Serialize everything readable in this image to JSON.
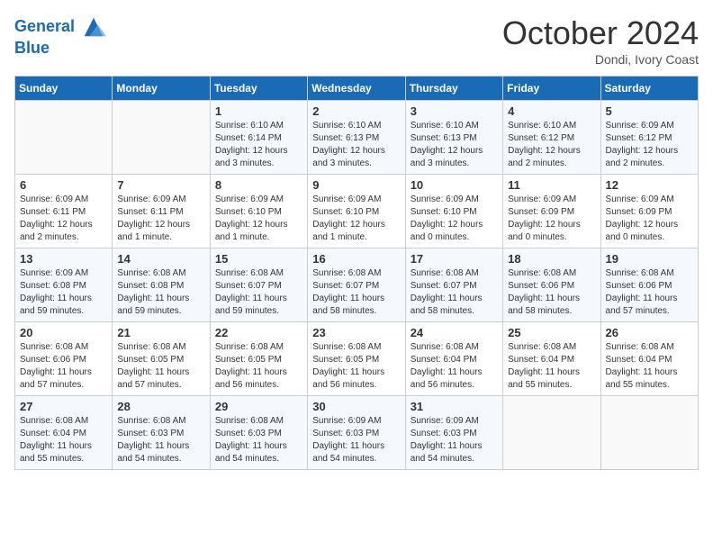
{
  "header": {
    "logo_line1": "General",
    "logo_line2": "Blue",
    "month": "October 2024",
    "location": "Dondi, Ivory Coast"
  },
  "days_of_week": [
    "Sunday",
    "Monday",
    "Tuesday",
    "Wednesday",
    "Thursday",
    "Friday",
    "Saturday"
  ],
  "weeks": [
    [
      {
        "day": "",
        "detail": ""
      },
      {
        "day": "",
        "detail": ""
      },
      {
        "day": "1",
        "detail": "Sunrise: 6:10 AM\nSunset: 6:14 PM\nDaylight: 12 hours and 3 minutes."
      },
      {
        "day": "2",
        "detail": "Sunrise: 6:10 AM\nSunset: 6:13 PM\nDaylight: 12 hours and 3 minutes."
      },
      {
        "day": "3",
        "detail": "Sunrise: 6:10 AM\nSunset: 6:13 PM\nDaylight: 12 hours and 3 minutes."
      },
      {
        "day": "4",
        "detail": "Sunrise: 6:10 AM\nSunset: 6:12 PM\nDaylight: 12 hours and 2 minutes."
      },
      {
        "day": "5",
        "detail": "Sunrise: 6:09 AM\nSunset: 6:12 PM\nDaylight: 12 hours and 2 minutes."
      }
    ],
    [
      {
        "day": "6",
        "detail": "Sunrise: 6:09 AM\nSunset: 6:11 PM\nDaylight: 12 hours and 2 minutes."
      },
      {
        "day": "7",
        "detail": "Sunrise: 6:09 AM\nSunset: 6:11 PM\nDaylight: 12 hours and 1 minute."
      },
      {
        "day": "8",
        "detail": "Sunrise: 6:09 AM\nSunset: 6:10 PM\nDaylight: 12 hours and 1 minute."
      },
      {
        "day": "9",
        "detail": "Sunrise: 6:09 AM\nSunset: 6:10 PM\nDaylight: 12 hours and 1 minute."
      },
      {
        "day": "10",
        "detail": "Sunrise: 6:09 AM\nSunset: 6:10 PM\nDaylight: 12 hours and 0 minutes."
      },
      {
        "day": "11",
        "detail": "Sunrise: 6:09 AM\nSunset: 6:09 PM\nDaylight: 12 hours and 0 minutes."
      },
      {
        "day": "12",
        "detail": "Sunrise: 6:09 AM\nSunset: 6:09 PM\nDaylight: 12 hours and 0 minutes."
      }
    ],
    [
      {
        "day": "13",
        "detail": "Sunrise: 6:09 AM\nSunset: 6:08 PM\nDaylight: 11 hours and 59 minutes."
      },
      {
        "day": "14",
        "detail": "Sunrise: 6:08 AM\nSunset: 6:08 PM\nDaylight: 11 hours and 59 minutes."
      },
      {
        "day": "15",
        "detail": "Sunrise: 6:08 AM\nSunset: 6:07 PM\nDaylight: 11 hours and 59 minutes."
      },
      {
        "day": "16",
        "detail": "Sunrise: 6:08 AM\nSunset: 6:07 PM\nDaylight: 11 hours and 58 minutes."
      },
      {
        "day": "17",
        "detail": "Sunrise: 6:08 AM\nSunset: 6:07 PM\nDaylight: 11 hours and 58 minutes."
      },
      {
        "day": "18",
        "detail": "Sunrise: 6:08 AM\nSunset: 6:06 PM\nDaylight: 11 hours and 58 minutes."
      },
      {
        "day": "19",
        "detail": "Sunrise: 6:08 AM\nSunset: 6:06 PM\nDaylight: 11 hours and 57 minutes."
      }
    ],
    [
      {
        "day": "20",
        "detail": "Sunrise: 6:08 AM\nSunset: 6:06 PM\nDaylight: 11 hours and 57 minutes."
      },
      {
        "day": "21",
        "detail": "Sunrise: 6:08 AM\nSunset: 6:05 PM\nDaylight: 11 hours and 57 minutes."
      },
      {
        "day": "22",
        "detail": "Sunrise: 6:08 AM\nSunset: 6:05 PM\nDaylight: 11 hours and 56 minutes."
      },
      {
        "day": "23",
        "detail": "Sunrise: 6:08 AM\nSunset: 6:05 PM\nDaylight: 11 hours and 56 minutes."
      },
      {
        "day": "24",
        "detail": "Sunrise: 6:08 AM\nSunset: 6:04 PM\nDaylight: 11 hours and 56 minutes."
      },
      {
        "day": "25",
        "detail": "Sunrise: 6:08 AM\nSunset: 6:04 PM\nDaylight: 11 hours and 55 minutes."
      },
      {
        "day": "26",
        "detail": "Sunrise: 6:08 AM\nSunset: 6:04 PM\nDaylight: 11 hours and 55 minutes."
      }
    ],
    [
      {
        "day": "27",
        "detail": "Sunrise: 6:08 AM\nSunset: 6:04 PM\nDaylight: 11 hours and 55 minutes."
      },
      {
        "day": "28",
        "detail": "Sunrise: 6:08 AM\nSunset: 6:03 PM\nDaylight: 11 hours and 54 minutes."
      },
      {
        "day": "29",
        "detail": "Sunrise: 6:08 AM\nSunset: 6:03 PM\nDaylight: 11 hours and 54 minutes."
      },
      {
        "day": "30",
        "detail": "Sunrise: 6:09 AM\nSunset: 6:03 PM\nDaylight: 11 hours and 54 minutes."
      },
      {
        "day": "31",
        "detail": "Sunrise: 6:09 AM\nSunset: 6:03 PM\nDaylight: 11 hours and 54 minutes."
      },
      {
        "day": "",
        "detail": ""
      },
      {
        "day": "",
        "detail": ""
      }
    ]
  ]
}
